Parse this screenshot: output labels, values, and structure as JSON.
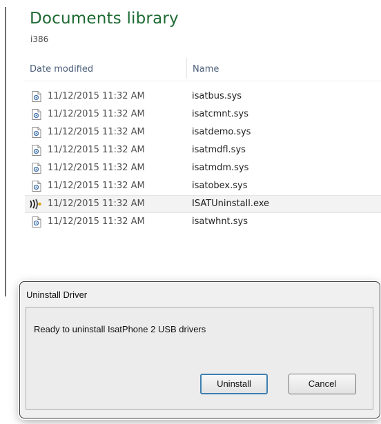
{
  "library": {
    "title": "Documents library",
    "subtitle": "i386"
  },
  "columns": {
    "date_modified": "Date modified",
    "name": "Name"
  },
  "files": [
    {
      "date": "11/12/2015 11:32 AM",
      "name": "isatbus.sys",
      "icon": "system-file-icon"
    },
    {
      "date": "11/12/2015 11:32 AM",
      "name": "isatcmnt.sys",
      "icon": "system-file-icon"
    },
    {
      "date": "11/12/2015 11:32 AM",
      "name": "isatdemo.sys",
      "icon": "system-file-icon"
    },
    {
      "date": "11/12/2015 11:32 AM",
      "name": "isatmdfl.sys",
      "icon": "system-file-icon"
    },
    {
      "date": "11/12/2015 11:32 AM",
      "name": "isatmdm.sys",
      "icon": "system-file-icon"
    },
    {
      "date": "11/12/2015 11:32 AM",
      "name": "isatobex.sys",
      "icon": "system-file-icon"
    },
    {
      "date": "11/12/2015 11:32 AM",
      "name": "ISATUninstall.exe",
      "icon": "satellite-app-icon",
      "selected": true
    },
    {
      "date": "11/12/2015 11:32 AM",
      "name": "isatwhnt.sys",
      "icon": "system-file-icon"
    }
  ],
  "dialog": {
    "title": "Uninstall Driver",
    "message": "Ready to uninstall IsatPhone 2 USB drivers",
    "uninstall_label": "Uninstall",
    "cancel_label": "Cancel"
  },
  "colors": {
    "title_green": "#1e6a33",
    "header_text": "#4c607a"
  }
}
